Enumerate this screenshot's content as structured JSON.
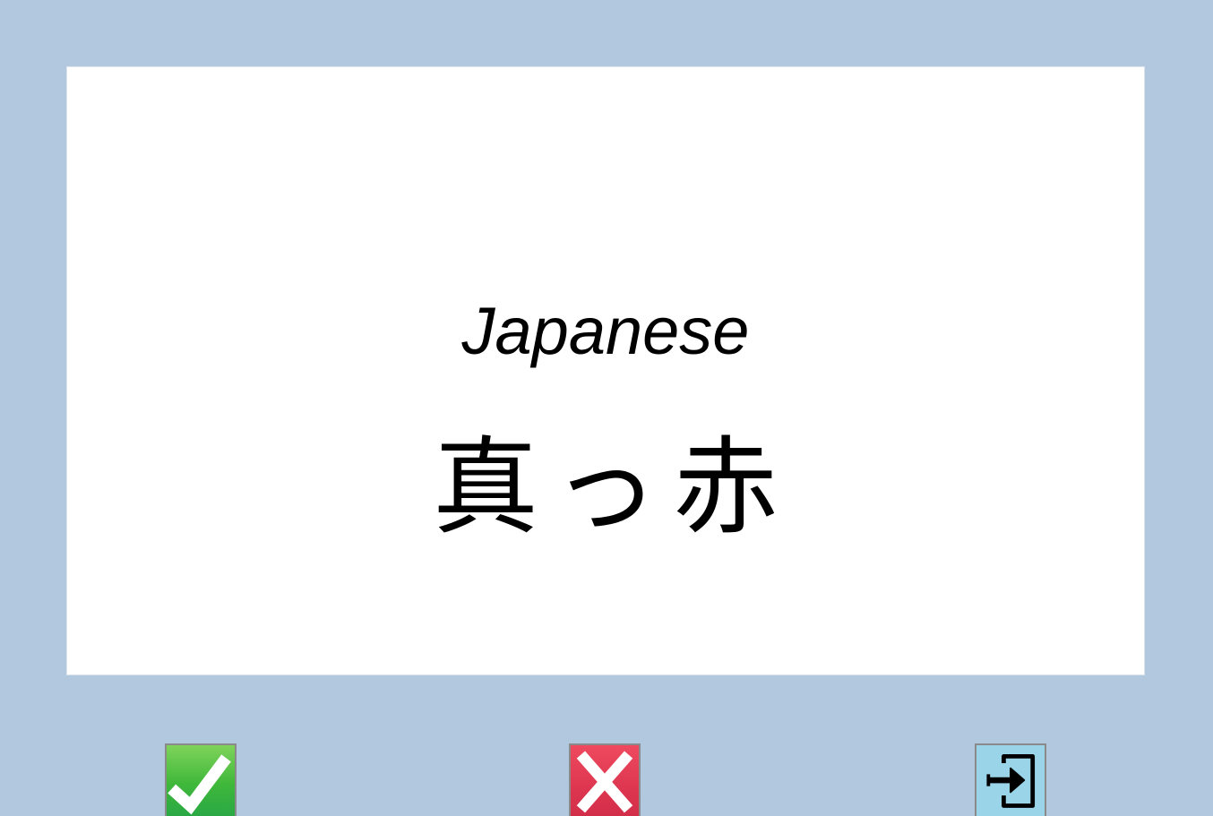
{
  "card": {
    "language": "Japanese",
    "word": "真っ赤"
  },
  "buttons": {
    "correct_icon": "checkmark-icon",
    "wrong_icon": "cross-icon",
    "exit_icon": "exit-icon"
  },
  "colors": {
    "background": "#b2c8de",
    "card": "#ffffff",
    "correct": "#3fb83a",
    "wrong": "#de3650",
    "exit": "#9ad4e8"
  }
}
